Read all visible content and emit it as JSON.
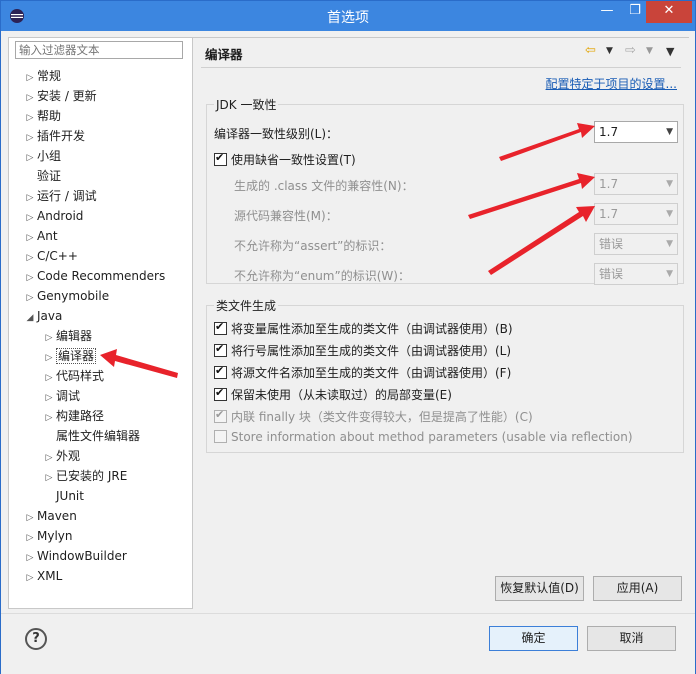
{
  "window": {
    "title": "首选项",
    "min": "—",
    "max": "❐",
    "close": "✕"
  },
  "filter": {
    "placeholder": "输入过滤器文本"
  },
  "tree": [
    {
      "label": "常规",
      "arrow": "▷",
      "indent": 0
    },
    {
      "label": "安装 / 更新",
      "arrow": "▷",
      "indent": 0
    },
    {
      "label": "帮助",
      "arrow": "▷",
      "indent": 0
    },
    {
      "label": "插件开发",
      "arrow": "▷",
      "indent": 0
    },
    {
      "label": "小组",
      "arrow": "▷",
      "indent": 0
    },
    {
      "label": "验证",
      "arrow": "",
      "indent": 0
    },
    {
      "label": "运行 / 调试",
      "arrow": "▷",
      "indent": 0
    },
    {
      "label": "Android",
      "arrow": "▷",
      "indent": 0
    },
    {
      "label": "Ant",
      "arrow": "▷",
      "indent": 0
    },
    {
      "label": "C/C++",
      "arrow": "▷",
      "indent": 0
    },
    {
      "label": "Code Recommenders",
      "arrow": "▷",
      "indent": 0
    },
    {
      "label": "Genymobile",
      "arrow": "▷",
      "indent": 0
    },
    {
      "label": "Java",
      "arrow": "◢",
      "indent": 0
    },
    {
      "label": "编辑器",
      "arrow": "▷",
      "indent": 1
    },
    {
      "label": "编译器",
      "arrow": "▷",
      "indent": 1,
      "selected": true
    },
    {
      "label": "代码样式",
      "arrow": "▷",
      "indent": 1
    },
    {
      "label": "调试",
      "arrow": "▷",
      "indent": 1
    },
    {
      "label": "构建路径",
      "arrow": "▷",
      "indent": 1
    },
    {
      "label": "属性文件编辑器",
      "arrow": "",
      "indent": 1
    },
    {
      "label": "外观",
      "arrow": "▷",
      "indent": 1
    },
    {
      "label": "已安装的 JRE",
      "arrow": "▷",
      "indent": 1
    },
    {
      "label": "JUnit",
      "arrow": "",
      "indent": 1
    },
    {
      "label": "Maven",
      "arrow": "▷",
      "indent": 0
    },
    {
      "label": "Mylyn",
      "arrow": "▷",
      "indent": 0
    },
    {
      "label": "WindowBuilder",
      "arrow": "▷",
      "indent": 0
    },
    {
      "label": "XML",
      "arrow": "▷",
      "indent": 0
    }
  ],
  "page": {
    "title": "编译器",
    "link": "配置特定于项目的设置...",
    "jdk_group": "JDK 一致性",
    "compliance_label": "编译器一致性级别(L)：",
    "compliance_value": "1.7",
    "use_default_label": "使用缺省一致性设置(T)",
    "class_compat_label": "生成的 .class 文件的兼容性(N)：",
    "class_compat_value": "1.7",
    "source_compat_label": "源代码兼容性(M)：",
    "source_compat_value": "1.7",
    "assert_label": "不允许称为“assert”的标识：",
    "assert_value": "错误",
    "enum_label": "不允许称为“enum”的标识(W)：",
    "enum_value": "错误",
    "classfile_group": "类文件生成",
    "options": [
      {
        "label": "将变量属性添加至生成的类文件（由调试器使用）(B)",
        "checked": true,
        "disabled": false
      },
      {
        "label": "将行号属性添加至生成的类文件（由调试器使用）(L)",
        "checked": true,
        "disabled": false
      },
      {
        "label": "将源文件名添加至生成的类文件（由调试器使用）(F)",
        "checked": true,
        "disabled": false
      },
      {
        "label": "保留未使用（从未读取过）的局部变量(E)",
        "checked": true,
        "disabled": false
      },
      {
        "label": "内联 finally 块（类文件变得较大，但是提高了性能）(C)",
        "checked": true,
        "disabled": true
      },
      {
        "label": "Store information about method parameters (usable via reflection)",
        "checked": false,
        "disabled": true
      }
    ],
    "restore_defaults": "恢复默认值(D)",
    "apply": "应用(A)"
  },
  "footer": {
    "ok": "确定",
    "cancel": "取消",
    "help": "?"
  }
}
